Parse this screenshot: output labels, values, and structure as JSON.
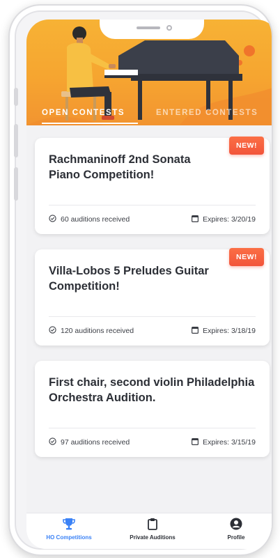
{
  "tabs": [
    {
      "label": "OPEN CONTESTS",
      "active": true
    },
    {
      "label": "ENTERED CONTESTS",
      "active": false
    }
  ],
  "contests": [
    {
      "title": "Rachmaninoff 2nd Sonata Piano Competition!",
      "badge": "NEW!",
      "auditions": "60 auditions received",
      "expires": "Expires: 3/20/19"
    },
    {
      "title": "Villa-Lobos 5 Preludes Guitar Competition!",
      "badge": "NEW!",
      "auditions": "120 auditions received",
      "expires": "Expires: 3/18/19"
    },
    {
      "title": "First chair, second violin Philadelphia Orchestra Audition.",
      "badge": "",
      "auditions": "97 auditions received",
      "expires": "Expires: 3/15/19"
    }
  ],
  "bottom_nav": [
    {
      "label": "HO Competitions",
      "icon": "trophy-icon",
      "active": true
    },
    {
      "label": "Private Auditions",
      "icon": "clipboard-icon",
      "active": false
    },
    {
      "label": "Profile",
      "icon": "profile-icon",
      "active": false
    }
  ],
  "colors": {
    "header_orange": "#f6a530",
    "badge_red": "#f2543a",
    "active_blue": "#3b82f6",
    "piano_dark": "#3b3f4a"
  }
}
